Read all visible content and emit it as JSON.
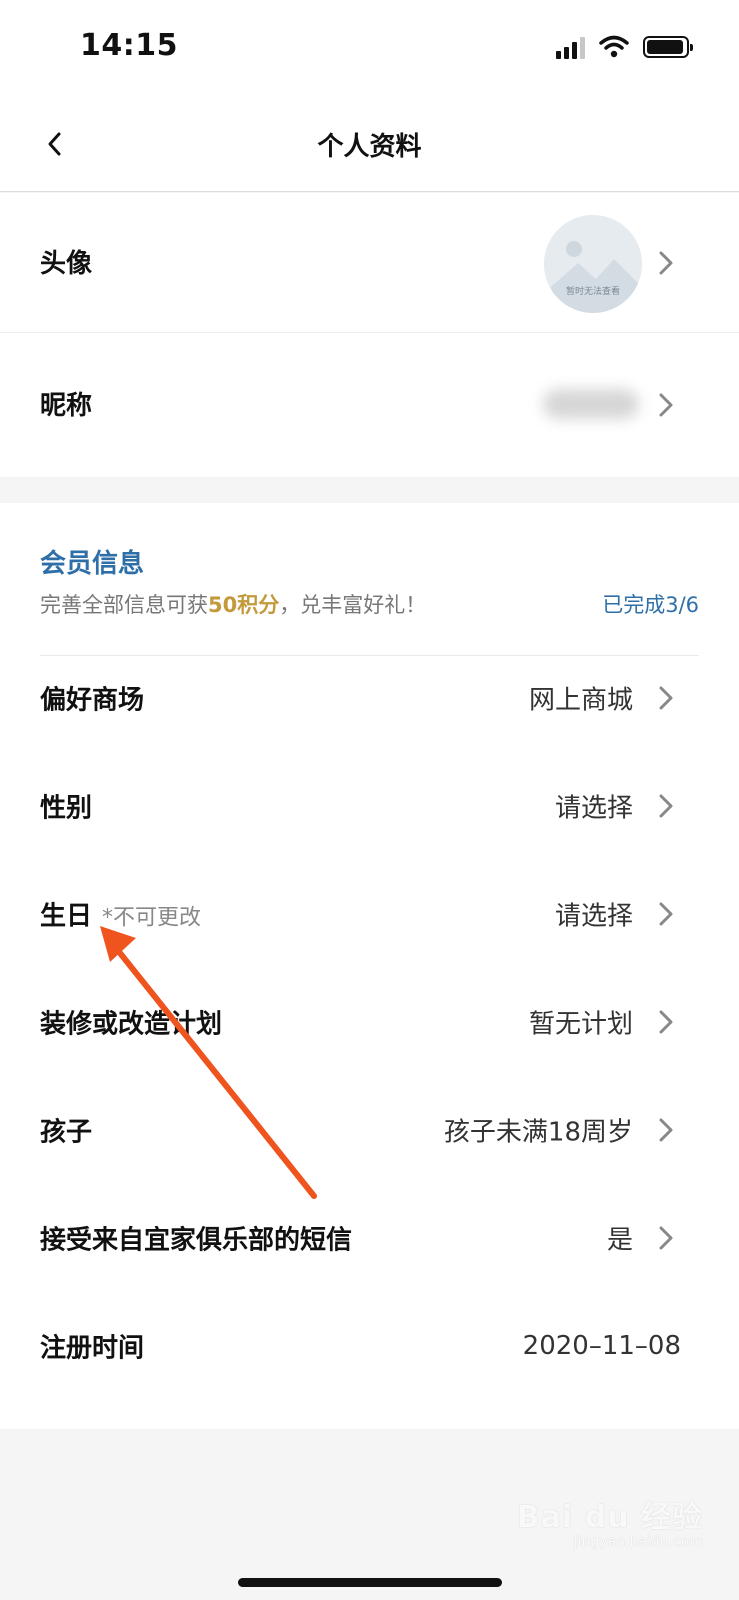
{
  "status_bar": {
    "time": "14:15"
  },
  "nav": {
    "title": "个人资料"
  },
  "profile": {
    "avatar_label": "头像",
    "avatar_placeholder_text": "暂时无法查看",
    "nickname_label": "昵称"
  },
  "member": {
    "title": "会员信息",
    "hint_prefix": "完善全部信息可获",
    "hint_points": "50积分",
    "hint_suffix": "，兑丰富好礼！",
    "progress": "已完成3/6",
    "rows": [
      {
        "label": "偏好商场",
        "value": "网上商城"
      },
      {
        "label": "性别",
        "value": "请选择"
      },
      {
        "label": "生日",
        "note": "*不可更改",
        "value": "请选择"
      },
      {
        "label": "装修或改造计划",
        "value": "暂无计划"
      },
      {
        "label": "孩子",
        "value": "孩子未满18周岁"
      },
      {
        "label": "接受来自宜家俱乐部的短信",
        "value": "是"
      },
      {
        "label": "注册时间",
        "value": "2020–11–08"
      }
    ]
  },
  "watermark": {
    "brand": "Bai du 经验",
    "url": "jingyan.baidu.com"
  },
  "colors": {
    "accent_blue": "#2f6fa8",
    "points_gold": "#c39a3b",
    "annotation_arrow": "#f0541e"
  }
}
